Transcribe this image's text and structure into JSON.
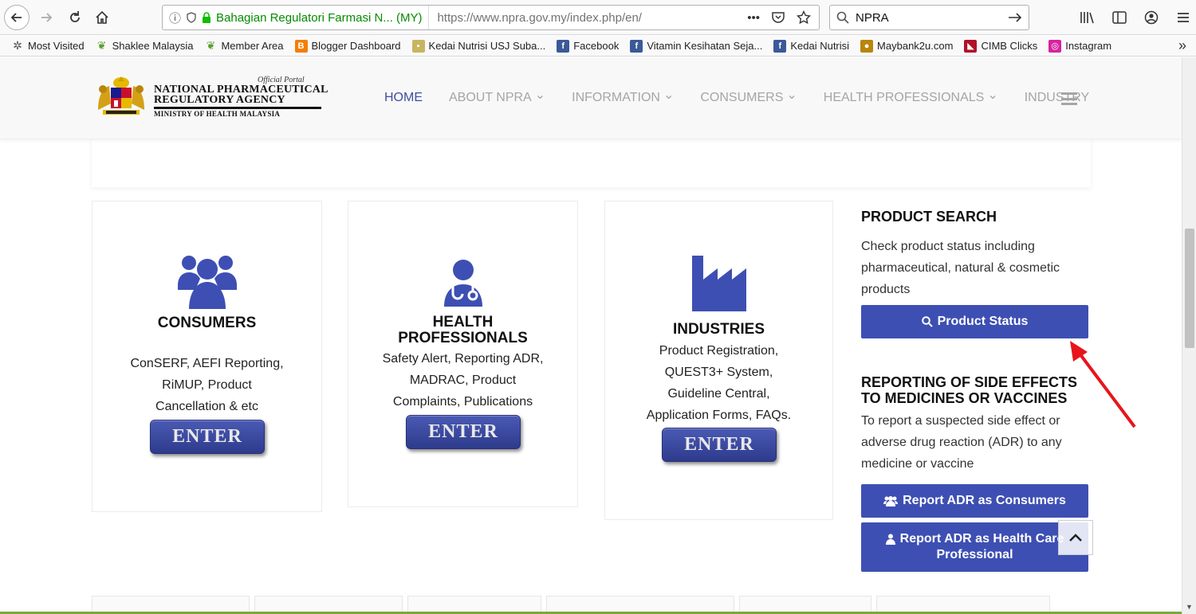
{
  "browser": {
    "identity": "Bahagian Regulatori Farmasi N... (MY)",
    "url": "https://www.npra.gov.my/index.php/en/",
    "search_query": "NPRA",
    "more_actions": "•••"
  },
  "bookmarks": [
    {
      "label": "Most Visited",
      "icon": "gear-icon",
      "color": "#555555"
    },
    {
      "label": "Shaklee Malaysia",
      "icon": "leaf-icon",
      "color": "#5a9e2b"
    },
    {
      "label": "Member Area",
      "icon": "leaf-icon",
      "color": "#5a9e2b"
    },
    {
      "label": "Blogger Dashboard",
      "icon": "blogger-icon",
      "color": "#f57d00"
    },
    {
      "label": "Kedai Nutrisi USJ Suba...",
      "icon": "site-icon",
      "color": "#c8b560"
    },
    {
      "label": "Facebook",
      "icon": "facebook-icon",
      "color": "#3b5998"
    },
    {
      "label": "Vitamin Kesihatan Seja...",
      "icon": "facebook-icon",
      "color": "#3b5998"
    },
    {
      "label": "Kedai Nutrisi",
      "icon": "facebook-icon",
      "color": "#3b5998"
    },
    {
      "label": "Maybank2u.com",
      "icon": "maybank-icon",
      "color": "#b8860b"
    },
    {
      "label": "CIMB Clicks",
      "icon": "cimb-icon",
      "color": "#b0122a"
    },
    {
      "label": "Instagram",
      "icon": "instagram-icon",
      "color": "#d6249f"
    }
  ],
  "logo": {
    "official": "Official Portal",
    "line1": "NATIONAL PHARMACEUTICAL",
    "line2": "REGULATORY AGENCY",
    "line3": "MINISTRY OF HEALTH MALAYSIA"
  },
  "menu": [
    {
      "label": "HOME",
      "dropdown": false,
      "active": true
    },
    {
      "label": "ABOUT NPRA",
      "dropdown": true,
      "active": false
    },
    {
      "label": "INFORMATION",
      "dropdown": true,
      "active": false
    },
    {
      "label": "CONSUMERS",
      "dropdown": true,
      "active": false
    },
    {
      "label": "HEALTH PROFESSIONALS",
      "dropdown": true,
      "active": false
    },
    {
      "label": "INDUSTRY",
      "dropdown": false,
      "active": false
    }
  ],
  "cards": {
    "consumers": {
      "title": "CONSUMERS",
      "desc": [
        "ConSERF, AEFI Reporting,",
        "RiMUP, Product",
        "Cancellation & etc"
      ],
      "enter": "ENTER"
    },
    "health": {
      "title1": "HEALTH",
      "title2": "PROFESSIONALS",
      "desc": [
        "Safety Alert, Reporting ADR,",
        "MADRAC, Product",
        "Complaints, Publications"
      ],
      "enter": "ENTER"
    },
    "industries": {
      "title": "INDUSTRIES",
      "desc": [
        "Product Registration,",
        "QUEST3+ System,",
        "Guideline Central,",
        "Application Forms, FAQs."
      ],
      "enter": "ENTER"
    }
  },
  "sidebar": {
    "product_search_title": "PRODUCT SEARCH",
    "product_search_text": [
      "Check product status including",
      "pharmaceutical, natural & cosmetic",
      "products"
    ],
    "product_status_btn": "Product Status",
    "reporting_title1": "REPORTING OF SIDE EFFECTS",
    "reporting_title2": "TO MEDICINES OR VACCINES",
    "reporting_text": [
      "To report a suspected side effect or",
      "adverse drug reaction (ADR) to any",
      "medicine or vaccine"
    ],
    "adr_consumers_btn": "Report ADR as Consumers",
    "adr_hcp_btn1": "Report ADR as Health Care",
    "adr_hcp_btn2": "Professional"
  },
  "colors": {
    "brand_blue": "#3e4fb3",
    "annotation_red": "#e8141b"
  }
}
